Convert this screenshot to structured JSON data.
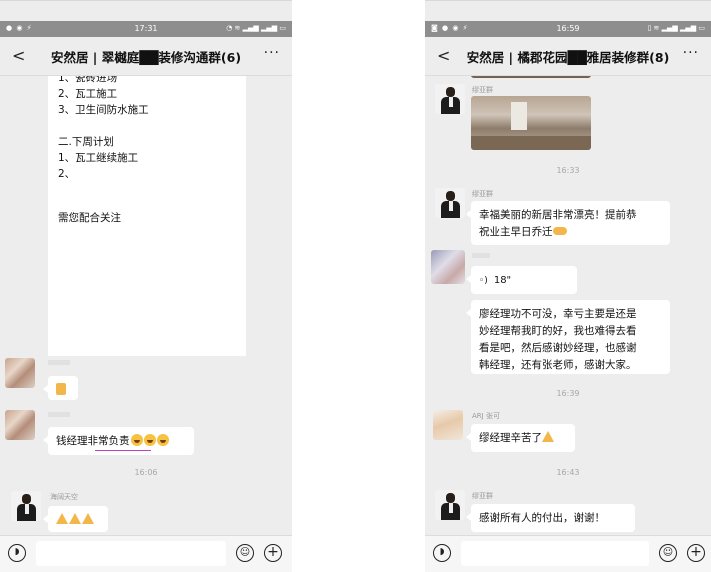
{
  "left": {
    "status": {
      "time": "17:31"
    },
    "header": {
      "title": "安然居 | 翠樾庭██装修沟通群(6)",
      "back": "<",
      "more": "···"
    },
    "doc_lines": [
      "1、瓷砖进场",
      "2、瓦工施工",
      "3、卫生间防水施工",
      "",
      "二.下周计划",
      "1、瓦工继续施工",
      "2、",
      "",
      "",
      "   需您配合关注"
    ],
    "messages": [
      {
        "sender": "",
        "text": ""
      },
      {
        "sender": "",
        "text": "钱经理非常负责"
      },
      {
        "time": "16:06"
      },
      {
        "sender": "海阔天空",
        "text": ""
      }
    ]
  },
  "right": {
    "status": {
      "time": "16:59"
    },
    "header": {
      "title": "安然居 | 橘郡花园██雅居装修群(8)",
      "back": "<",
      "more": "···"
    },
    "messages": [
      {
        "sender": "缪亚群",
        "type": "image"
      },
      {
        "time": "16:33"
      },
      {
        "sender": "缪亚群",
        "text_lines": [
          "幸福美丽的新居非常漂亮！提前恭",
          "祝业主早日乔迁"
        ]
      },
      {
        "sender": "",
        "voice": "18\""
      },
      {
        "text_lines": [
          "廖经理功不可没，幸亏主要是还是",
          "妙经理帮我盯的好，我也难得去看",
          "看是吧，然后感谢妙经理，也感谢",
          "韩经理，还有张老师，感谢大家。"
        ]
      },
      {
        "time": "16:39"
      },
      {
        "sender": "ARJ 张可",
        "text": "缪经理辛苦了"
      },
      {
        "time": "16:43"
      },
      {
        "sender": "缪亚群",
        "text": "感谢所有人的付出，谢谢！"
      }
    ]
  },
  "icons": {
    "voice": "voice-icon",
    "emoji": "emoji-icon",
    "plus": "plus-icon",
    "back": "back-arrow-icon",
    "more": "more-icon"
  },
  "colors": {
    "chat_bg": "#ededed",
    "bubble": "#ffffff",
    "statusbar": "#8e8e8e",
    "timestamp": "#a8a8a8"
  }
}
